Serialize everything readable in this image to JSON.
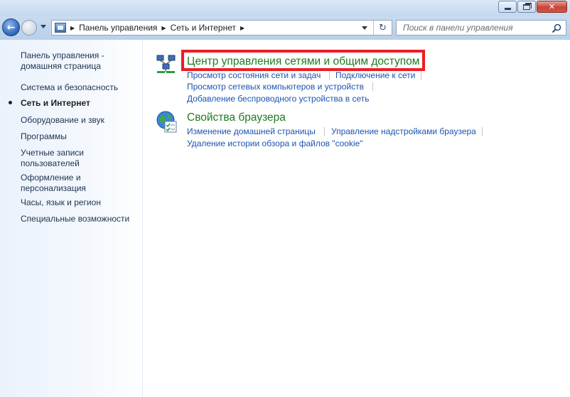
{
  "window": {
    "buttons": {
      "minimize": "minimize",
      "maximize": "maximize",
      "close": "close"
    }
  },
  "address_bar": {
    "breadcrumbs": [
      "Панель управления",
      "Сеть и Интернет"
    ],
    "refresh_icon": "refresh-icon"
  },
  "search": {
    "placeholder": "Поиск в панели управления",
    "icon": "search-icon"
  },
  "sidebar": {
    "items": [
      {
        "label": "Панель управления - домашняя страница",
        "current": false
      },
      {
        "label": "Система и безопасность",
        "current": false
      },
      {
        "label": "Сеть и Интернет",
        "current": true
      },
      {
        "label": "Оборудование и звук",
        "current": false
      },
      {
        "label": "Программы",
        "current": false
      },
      {
        "label": "Учетные записи пользователей",
        "current": false
      },
      {
        "label": "Оформление и персонализация",
        "current": false
      },
      {
        "label": "Часы, язык и регион",
        "current": false
      },
      {
        "label": "Специальные возможности",
        "current": false
      }
    ]
  },
  "categories": [
    {
      "title": "Центр управления сетями и общим доступом",
      "icon": "network-center-icon",
      "highlighted": true,
      "tasks": [
        "Просмотр состояния сети и задач",
        "Подключение к сети",
        "Просмотр сетевых компьютеров и устройств",
        "Добавление беспроводного устройства в сеть"
      ]
    },
    {
      "title": "Свойства браузера",
      "icon": "internet-options-icon",
      "highlighted": false,
      "tasks": [
        "Изменение домашней страницы",
        "Управление надстройками браузера",
        "Удаление истории обзора и файлов \"cookie\""
      ]
    }
  ],
  "colors": {
    "highlight_border": "#ee1c25",
    "category_title": "#1e7a1e",
    "task_link": "#1a55b0"
  }
}
